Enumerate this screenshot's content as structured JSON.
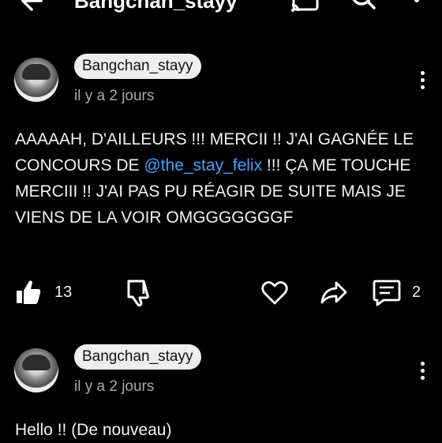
{
  "header": {
    "title": "Bangchan_stayy",
    "icons": [
      "back-arrow-icon",
      "cast-icon",
      "search-icon",
      "more-vert-icon"
    ]
  },
  "comments": [
    {
      "author": "Bangchan_stayy",
      "time": "il y a 2 jours",
      "text_before": "AAAAAH, D'AILLEURS !!! MERCII !! J'AI GAGNÉE LE CONCOURS DE ",
      "mention": "@the_stay_felix",
      "text_after": " !!! ÇA ME TOUCHE MERCIII !! J'AI PAS PU RÉAGIR DE SUITE MAIS JE VIENS DE LA VOIR OMGGGGGGGF",
      "likes": "13",
      "replies": "2"
    },
    {
      "author": "Bangchan_stayy",
      "time": "il y a 2 jours",
      "text_before": "Hello !! (De nouveau)",
      "mention": "",
      "text_after": ""
    }
  ],
  "colors": {
    "background": "#000000",
    "mention": "#3ea6ff",
    "author_chip": "#eeeeee"
  }
}
